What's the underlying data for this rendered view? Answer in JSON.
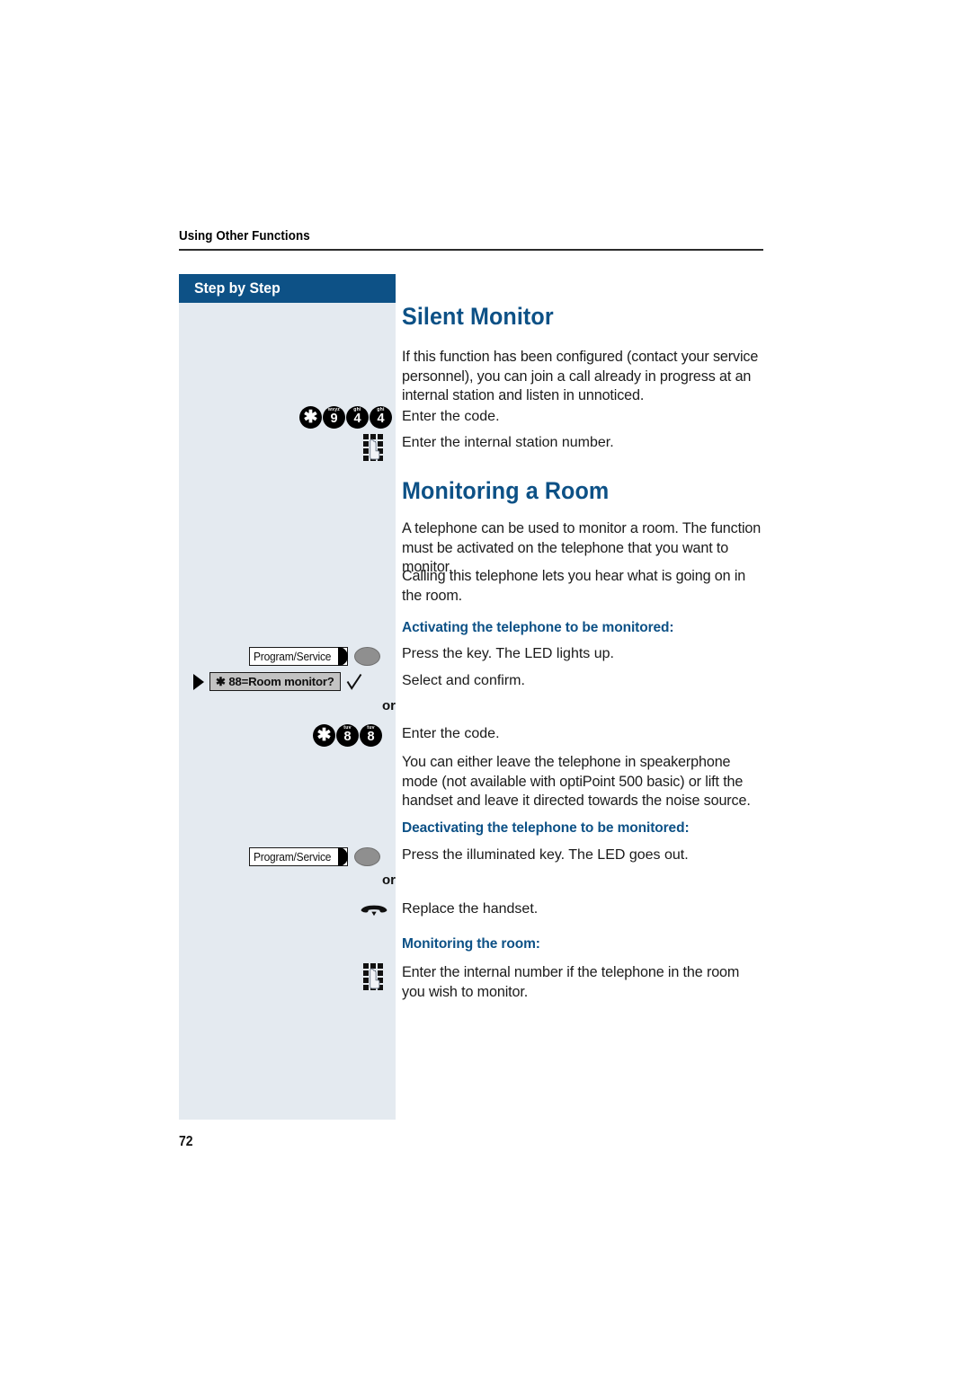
{
  "page": {
    "running_header": "Using Other Functions",
    "page_number": "72",
    "accent_color": "#0d5186",
    "sidebar_color": "#e4eaf0"
  },
  "sidebar": {
    "header_label": "Step by Step"
  },
  "sections": [
    {
      "title": "Silent Monitor",
      "intro": "If this function has been configured (contact your service personnel), you can join a call already in progress at an internal station and listen in unnoticed."
    },
    {
      "title": "Monitoring a Room",
      "intro_1": "A telephone can be used to monitor a room. The function must be activated on the telephone that you want to monitor.",
      "intro_2": "Calling this telephone lets you hear what is going on in the room."
    }
  ],
  "steps": {
    "enter_code_1": "Enter the code.",
    "enter_station_number": "Enter the internal station number.",
    "activating_heading": "Activating the telephone to be monitored:",
    "press_key_led_on": "Press the key. The LED lights up.",
    "select_and_confirm": "Select and confirm.",
    "or_1": "or",
    "enter_code_2": "Enter the code.",
    "speakerphone_note": "You can either leave the telephone in speakerphone mode (not available with optiPoint 500 basic) or lift the handset and leave it directed towards the noise source.",
    "deactivating_heading": "Deactivating the telephone to be monitored:",
    "press_illuminated_key": "Press the illuminated key. The LED goes out.",
    "or_2": "or",
    "replace_handset": "Replace the handset.",
    "monitoring_heading": "Monitoring the room:",
    "monitor_instruction": "Enter the internal number if the telephone in the room you wish to monitor."
  },
  "keys": {
    "code_944": [
      {
        "letters": "",
        "digit": "✱",
        "name": "star-key"
      },
      {
        "letters": "wxyz",
        "digit": "9",
        "name": "digit-9-key"
      },
      {
        "letters": "ghi",
        "digit": "4",
        "name": "digit-4-key"
      },
      {
        "letters": "ghi",
        "digit": "4",
        "name": "digit-4-key"
      }
    ],
    "code_88": [
      {
        "letters": "",
        "digit": "✱",
        "name": "star-key"
      },
      {
        "letters": "tuv",
        "digit": "8",
        "name": "digit-8-key"
      },
      {
        "letters": "tuv",
        "digit": "8",
        "name": "digit-8-key"
      }
    ],
    "program_service_label": "Program/Service",
    "room_monitor_display": "✱ 88=Room monitor?"
  },
  "icons": {
    "keypad": "keypad-icon",
    "handset_onhook": "handset-onhook-icon",
    "check": "check-icon",
    "led": "led-indicator"
  }
}
